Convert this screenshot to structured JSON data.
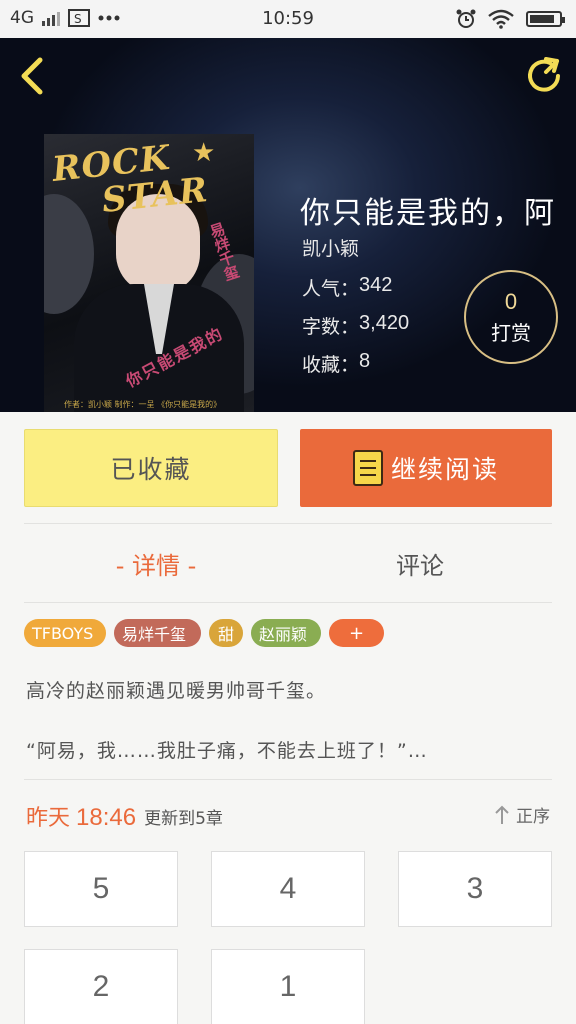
{
  "status_bar": {
    "network": "4G",
    "time": "10:59"
  },
  "book": {
    "title": "你只能是我的，阿",
    "author": "凯小颖",
    "stats": [
      {
        "label": "人气：",
        "value": "342"
      },
      {
        "label": "字数：",
        "value": "3,420"
      },
      {
        "label": "收藏：",
        "value": "8"
      }
    ],
    "tip": {
      "count": "0",
      "label": "打赏"
    },
    "cover": {
      "title_line1": "ROCK",
      "title_line2": "STAR",
      "vertical_text": "易烊千玺",
      "subtitle": "你只能是我的",
      "credit": "作者：凯小颖   制作：一呈   《你只能是我的》"
    }
  },
  "actions": {
    "collected_label": "已收藏",
    "read_label": "继续阅读"
  },
  "tabs": [
    {
      "label": "- 详情 -",
      "active": true
    },
    {
      "label": "评论",
      "active": false
    }
  ],
  "tags": [
    {
      "label": "TFBOYS",
      "color": "#f0a93a"
    },
    {
      "label": "易烊千玺",
      "color": "#c26a5a"
    },
    {
      "label": "甜",
      "color": "#d9a53a"
    },
    {
      "label": "赵丽颖",
      "color": "#8aad52"
    },
    {
      "label": "+",
      "color": "#ee6d3c"
    }
  ],
  "description": {
    "line1": "高冷的赵丽颖遇见暖男帅哥千玺。",
    "line2": "“阿易，我……我肚子痛，不能去上班了！”…"
  },
  "update": {
    "day": "昨天",
    "time": "18:46",
    "text": "更新到5章",
    "sort_label": "正序"
  },
  "chapters": [
    "5",
    "4",
    "3",
    "2",
    "1"
  ],
  "colors": {
    "accent": "#ea6a3b",
    "collected_bg": "#fbee82",
    "hero_bg": "#0b1122"
  }
}
